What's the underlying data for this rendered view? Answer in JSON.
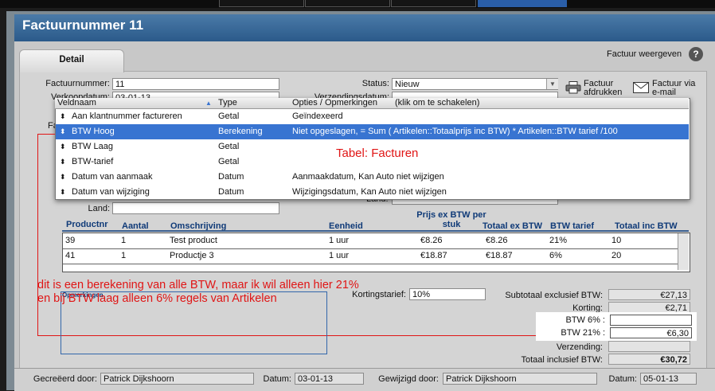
{
  "window": {
    "title": "Factuurnummer 11"
  },
  "tabs": {
    "detail": "Detail"
  },
  "header_links": {
    "factuur_weergeven": "Factuur weergeven",
    "help": "?"
  },
  "form": {
    "factuurnummer_label": "Factuurnummer:",
    "factuurnummer_value": "11",
    "verkoopdatum_label": "Verkoopdatum:",
    "verkoopdatum_value": "03-01-13",
    "status_label": "Status:",
    "status_value": "Nieuw",
    "verzendingsdatum_label": "Verzendingsdatum:",
    "land_label": "Land:",
    "land2_label": "Land:",
    "fa_stub": "Fa"
  },
  "actions": {
    "afdrukken_line1": "Factuur",
    "afdrukken_line2": "afdrukken",
    "email_line1": "Factuur via",
    "email_line2": "e-mail"
  },
  "popup": {
    "headers": {
      "veldnaam": "Veldnaam",
      "type": "Type",
      "opties": "Opties / Opmerkingen",
      "hint": "(klik om te schakelen)"
    },
    "rows": [
      {
        "name": "Aan klantnummer factureren",
        "type": "Getal",
        "opties": "Geïndexeerd"
      },
      {
        "name": "BTW Hoog",
        "type": "Berekening",
        "opties": "Niet opgeslagen, = Sum ( Artikelen::Totaalprijs inc BTW) * Artikelen::BTW tarief /100"
      },
      {
        "name": "BTW Laag",
        "type": "Getal",
        "opties": ""
      },
      {
        "name": "BTW-tarief",
        "type": "Getal",
        "opties": ""
      },
      {
        "name": "Datum van aanmaak",
        "type": "Datum",
        "opties": "Aanmaakdatum, Kan Auto niet wijzigen"
      },
      {
        "name": "Datum van wijziging",
        "type": "Datum",
        "opties": "Wijzigingsdatum, Kan Auto niet wijzigen"
      }
    ],
    "table_annotation": "Tabel: Facturen"
  },
  "grid": {
    "headers": {
      "productnr": "Productnr",
      "aantal": "Aantal",
      "omschrijving": "Omschrijving",
      "eenheid": "Eenheid",
      "prijs_line1": "Prijs ex BTW per",
      "prijs_line2": "stuk",
      "totaal_ex": "Totaal ex BTW",
      "btw_tarief": "BTW tarief",
      "totaal_inc": "Totaal inc BTW"
    },
    "rows": [
      {
        "productnr": "39",
        "aantal": "1",
        "omschrijving": "Test product",
        "eenheid": "1 uur",
        "prijs": "€8.26",
        "totaal_ex": "€8.26",
        "btw": "21%",
        "totaal_inc": "10"
      },
      {
        "productnr": "41",
        "aantal": "1",
        "omschrijving": "Productje 3",
        "eenheid": "1 uur",
        "prijs": "€18.87",
        "totaal_ex": "€18.87",
        "btw": "6%",
        "totaal_inc": "20"
      }
    ]
  },
  "annotation": {
    "line1": "dit is een berekening van alle BTW, maar ik wil alleen hier 21%",
    "line2": "en bij BTW laag alleen 6% regels van Artikelen"
  },
  "opmerkingen_label": "Opmerkingen",
  "kortingstarief": {
    "label": "Kortingstarief:",
    "value": "10%"
  },
  "totals": {
    "subtotaal_label": "Subtotaal exclusief BTW:",
    "subtotaal_value": "€27,13",
    "korting_label": "Korting:",
    "korting_value": "€2,71",
    "btw6_label": "BTW  6% :",
    "btw6_value": "",
    "btw21_label": "BTW  21% :",
    "btw21_value": "€6,30",
    "verzending_label": "Verzending:",
    "verzending_value": "",
    "totaal_label": "Totaal inclusief BTW:",
    "totaal_value": "€30,72"
  },
  "footer": {
    "gecreeerd_label": "Gecreëerd door:",
    "gecreeerd_value": "Patrick Dijkshoorn",
    "datum1_label": "Datum:",
    "datum1_value": "03-01-13",
    "gewijzigd_label": "Gewijzigd door:",
    "gewijzigd_value": "Patrick Dijkshoorn",
    "datum2_label": "Datum:",
    "datum2_value": "05-01-13"
  },
  "colors": {
    "accent": "#3874d1",
    "title_bar": "#2b5a8a",
    "annotation": "#e01515",
    "header_text": "#0f3a78"
  }
}
